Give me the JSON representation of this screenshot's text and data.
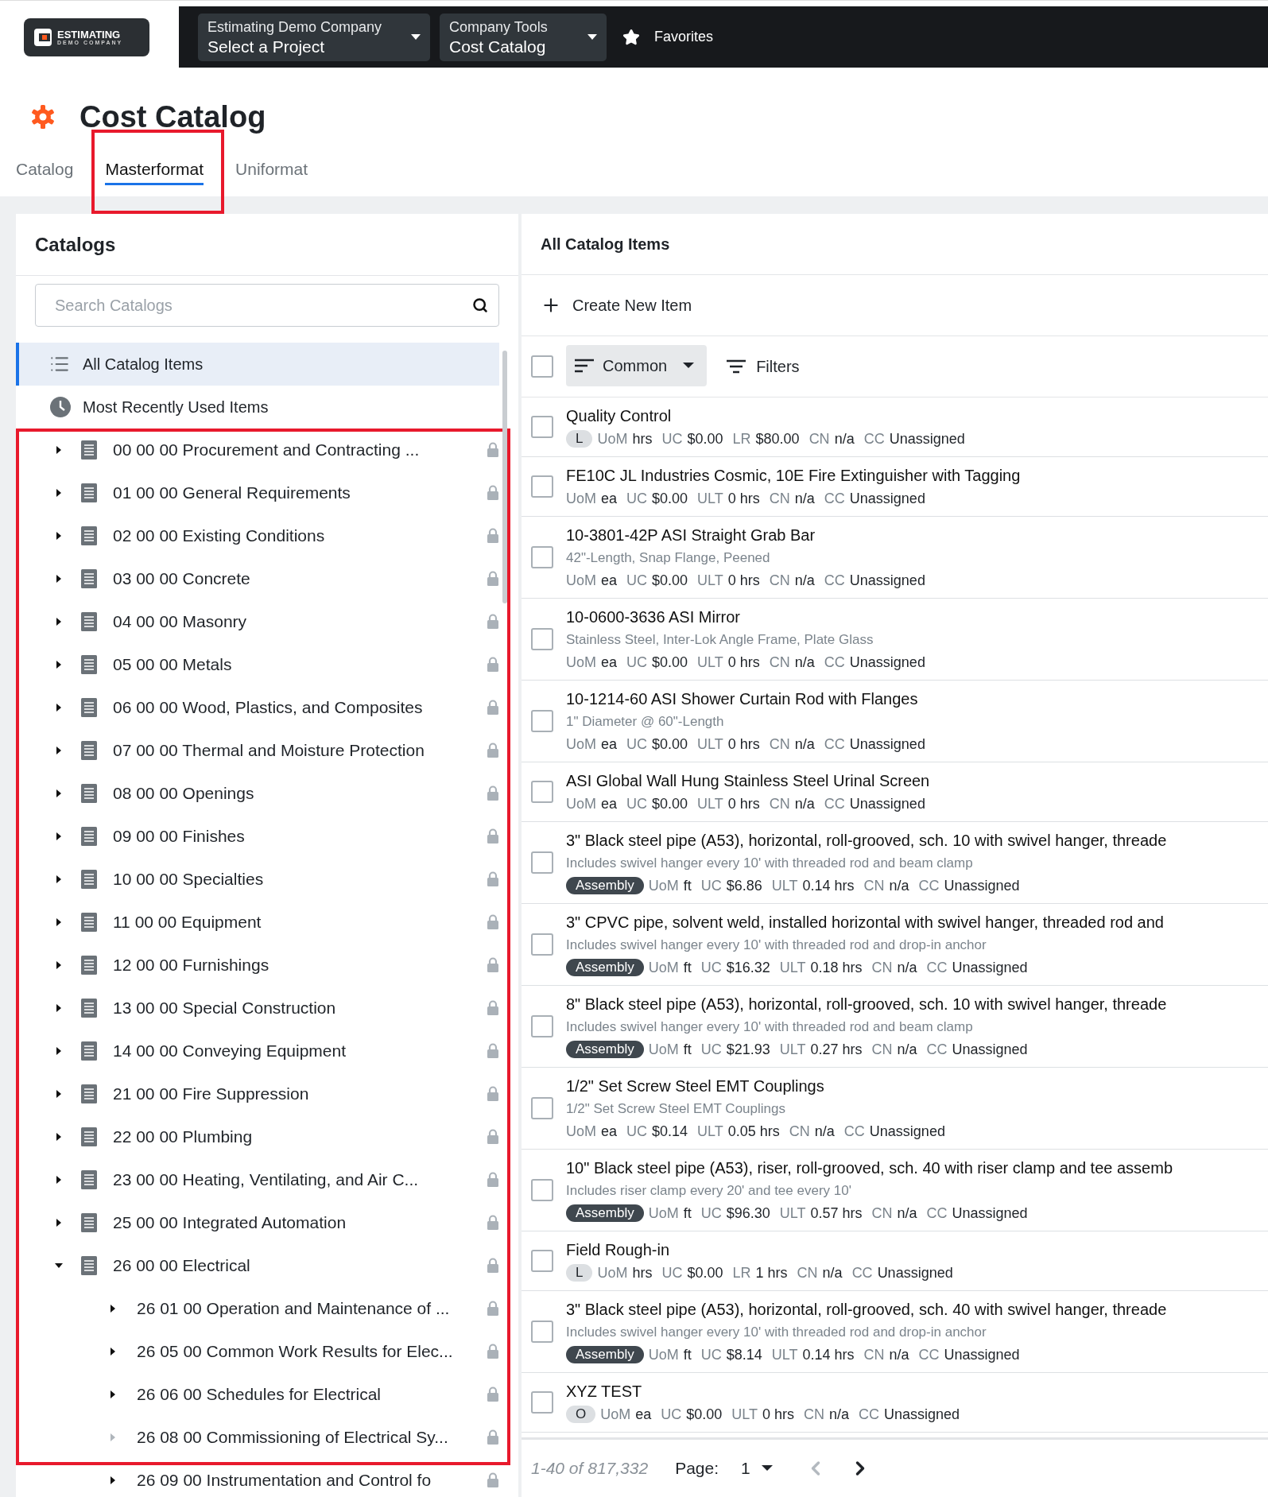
{
  "logo": {
    "title": "ESTIMATING",
    "subtitle": "DEMO COMPANY"
  },
  "nav": [
    {
      "top": "Estimating Demo Company",
      "bottom": "Select a Project"
    },
    {
      "top": "Company Tools",
      "bottom": "Cost Catalog"
    }
  ],
  "favorites": "Favorites",
  "page_title": "Cost Catalog",
  "tabs": [
    {
      "label": "Catalog",
      "selected": false,
      "highlighted": false
    },
    {
      "label": "Masterformat",
      "selected": true,
      "highlighted": true
    },
    {
      "label": "Uniformat",
      "selected": false,
      "highlighted": false
    }
  ],
  "catalogs": {
    "title": "Catalogs",
    "search": {
      "placeholder": "Search Catalogs"
    },
    "fixed": [
      {
        "kind": "list",
        "label": "All Catalog Items",
        "selected": true
      },
      {
        "kind": "clock",
        "label": "Most Recently Used Items",
        "selected": false
      }
    ],
    "tree_highlighted": true,
    "tree": [
      {
        "label": "00 00 00 Procurement and Contracting ...",
        "expanded": false,
        "expandable": true,
        "locked": true
      },
      {
        "label": "01 00 00 General Requirements",
        "expanded": false,
        "expandable": true,
        "locked": true
      },
      {
        "label": "02 00 00 Existing Conditions",
        "expanded": false,
        "expandable": true,
        "locked": true
      },
      {
        "label": "03 00 00 Concrete",
        "expanded": false,
        "expandable": true,
        "locked": true
      },
      {
        "label": "04 00 00 Masonry",
        "expanded": false,
        "expandable": true,
        "locked": true
      },
      {
        "label": "05 00 00 Metals",
        "expanded": false,
        "expandable": true,
        "locked": true
      },
      {
        "label": "06 00 00 Wood, Plastics, and Composites",
        "expanded": false,
        "expandable": true,
        "locked": true
      },
      {
        "label": "07 00 00 Thermal and Moisture Protection",
        "expanded": false,
        "expandable": true,
        "locked": true
      },
      {
        "label": "08 00 00 Openings",
        "expanded": false,
        "expandable": true,
        "locked": true
      },
      {
        "label": "09 00 00 Finishes",
        "expanded": false,
        "expandable": true,
        "locked": true
      },
      {
        "label": "10 00 00 Specialties",
        "expanded": false,
        "expandable": true,
        "locked": true
      },
      {
        "label": "11 00 00 Equipment",
        "expanded": false,
        "expandable": true,
        "locked": true
      },
      {
        "label": "12 00 00 Furnishings",
        "expanded": false,
        "expandable": true,
        "locked": true
      },
      {
        "label": "13 00 00 Special Construction",
        "expanded": false,
        "expandable": true,
        "locked": true
      },
      {
        "label": "14 00 00 Conveying Equipment",
        "expanded": false,
        "expandable": true,
        "locked": true
      },
      {
        "label": "21 00 00 Fire Suppression",
        "expanded": false,
        "expandable": true,
        "locked": true
      },
      {
        "label": "22 00 00 Plumbing",
        "expanded": false,
        "expandable": true,
        "locked": true
      },
      {
        "label": "23 00 00 Heating, Ventilating, and Air C...",
        "expanded": false,
        "expandable": true,
        "locked": true
      },
      {
        "label": "25 00 00 Integrated Automation",
        "expanded": false,
        "expandable": true,
        "locked": true
      },
      {
        "label": "26 00 00 Electrical",
        "expanded": true,
        "expandable": true,
        "locked": true,
        "children": [
          {
            "label": "26 01 00 Operation and Maintenance of ...",
            "expanded": false,
            "expandable": true,
            "locked": true
          },
          {
            "label": "26 05 00 Common Work Results for Elec...",
            "expanded": false,
            "expandable": true,
            "locked": true
          },
          {
            "label": "26 06 00 Schedules for Electrical",
            "expanded": false,
            "expandable": true,
            "locked": true
          },
          {
            "label": "26 08 00 Commissioning of Electrical Sy...",
            "expanded": false,
            "expandable": false,
            "locked": true
          },
          {
            "label": "26 09 00 Instrumentation and Control fo",
            "expanded": false,
            "expandable": true,
            "locked": true
          }
        ]
      }
    ]
  },
  "items_panel": {
    "title": "All Catalog Items",
    "create": "Create New Item",
    "sort": "Common",
    "filters": "Filters",
    "select_all": false,
    "items": [
      {
        "title": "Quality Control",
        "badge": {
          "label": "L",
          "kind": "light"
        },
        "checked": false,
        "meta": [
          {
            "label": "UoM",
            "value": "hrs"
          },
          {
            "label": "UC",
            "value": "$0.00"
          },
          {
            "label": "LR",
            "value": "$80.00"
          },
          {
            "label": "CN",
            "value": "n/a"
          },
          {
            "label": "CC",
            "value": "Unassigned"
          }
        ]
      },
      {
        "title": "FE10C JL Industries Cosmic, 10E Fire Extinguisher with Tagging",
        "checked": false,
        "meta": [
          {
            "label": "UoM",
            "value": "ea"
          },
          {
            "label": "UC",
            "value": "$0.00"
          },
          {
            "label": "ULT",
            "value": "0 hrs"
          },
          {
            "label": "CN",
            "value": "n/a"
          },
          {
            "label": "CC",
            "value": "Unassigned"
          }
        ]
      },
      {
        "title": "10-3801-42P ASI Straight Grab Bar",
        "subtitle": "42\"-Length, Snap Flange, Peened",
        "checked": false,
        "meta": [
          {
            "label": "UoM",
            "value": "ea"
          },
          {
            "label": "UC",
            "value": "$0.00"
          },
          {
            "label": "ULT",
            "value": "0 hrs"
          },
          {
            "label": "CN",
            "value": "n/a"
          },
          {
            "label": "CC",
            "value": "Unassigned"
          }
        ]
      },
      {
        "title": "10-0600-3636 ASI Mirror",
        "subtitle": "Stainless Steel, Inter-Lok Angle Frame, Plate Glass",
        "checked": false,
        "meta": [
          {
            "label": "UoM",
            "value": "ea"
          },
          {
            "label": "UC",
            "value": "$0.00"
          },
          {
            "label": "ULT",
            "value": "0 hrs"
          },
          {
            "label": "CN",
            "value": "n/a"
          },
          {
            "label": "CC",
            "value": "Unassigned"
          }
        ]
      },
      {
        "title": "10-1214-60 ASI Shower Curtain Rod with Flanges",
        "subtitle": "1\" Diameter @ 60\"-Length",
        "checked": false,
        "meta": [
          {
            "label": "UoM",
            "value": "ea"
          },
          {
            "label": "UC",
            "value": "$0.00"
          },
          {
            "label": "ULT",
            "value": "0 hrs"
          },
          {
            "label": "CN",
            "value": "n/a"
          },
          {
            "label": "CC",
            "value": "Unassigned"
          }
        ]
      },
      {
        "title": "ASI Global Wall Hung Stainless Steel Urinal Screen",
        "checked": false,
        "meta": [
          {
            "label": "UoM",
            "value": "ea"
          },
          {
            "label": "UC",
            "value": "$0.00"
          },
          {
            "label": "ULT",
            "value": "0 hrs"
          },
          {
            "label": "CN",
            "value": "n/a"
          },
          {
            "label": "CC",
            "value": "Unassigned"
          }
        ]
      },
      {
        "title": "3\" Black steel pipe (A53), horizontal, roll-grooved, sch. 10 with swivel hanger, threade",
        "subtitle": "Includes swivel hanger every 10' with threaded rod and beam clamp",
        "badge": {
          "label": "Assembly",
          "kind": "dark"
        },
        "checked": false,
        "meta": [
          {
            "label": "UoM",
            "value": "ft"
          },
          {
            "label": "UC",
            "value": "$6.86"
          },
          {
            "label": "ULT",
            "value": "0.14 hrs"
          },
          {
            "label": "CN",
            "value": "n/a"
          },
          {
            "label": "CC",
            "value": "Unassigned"
          }
        ]
      },
      {
        "title": "3\" CPVC pipe, solvent weld, installed horizontal with swivel hanger, threaded rod and",
        "subtitle": "Includes swivel hanger every 10' with threaded rod and drop-in anchor",
        "badge": {
          "label": "Assembly",
          "kind": "dark"
        },
        "checked": false,
        "meta": [
          {
            "label": "UoM",
            "value": "ft"
          },
          {
            "label": "UC",
            "value": "$16.32"
          },
          {
            "label": "ULT",
            "value": "0.18 hrs"
          },
          {
            "label": "CN",
            "value": "n/a"
          },
          {
            "label": "CC",
            "value": "Unassigned"
          }
        ]
      },
      {
        "title": "8\" Black steel pipe (A53), horizontal, roll-grooved, sch. 10 with swivel hanger, threade",
        "subtitle": "Includes swivel hanger every 10' with threaded rod and beam clamp",
        "badge": {
          "label": "Assembly",
          "kind": "dark"
        },
        "checked": false,
        "meta": [
          {
            "label": "UoM",
            "value": "ft"
          },
          {
            "label": "UC",
            "value": "$21.93"
          },
          {
            "label": "ULT",
            "value": "0.27 hrs"
          },
          {
            "label": "CN",
            "value": "n/a"
          },
          {
            "label": "CC",
            "value": "Unassigned"
          }
        ]
      },
      {
        "title": "1/2\" Set Screw Steel EMT Couplings",
        "subtitle": "1/2\" Set Screw Steel EMT Couplings",
        "checked": false,
        "meta": [
          {
            "label": "UoM",
            "value": "ea"
          },
          {
            "label": "UC",
            "value": "$0.14"
          },
          {
            "label": "ULT",
            "value": "0.05 hrs"
          },
          {
            "label": "CN",
            "value": "n/a"
          },
          {
            "label": "CC",
            "value": "Unassigned"
          }
        ]
      },
      {
        "title": "10\" Black steel pipe (A53), riser, roll-grooved, sch. 40 with riser clamp and tee assemb",
        "subtitle": "Includes riser clamp every 20' and tee every 10'",
        "badge": {
          "label": "Assembly",
          "kind": "dark"
        },
        "checked": false,
        "meta": [
          {
            "label": "UoM",
            "value": "ft"
          },
          {
            "label": "UC",
            "value": "$96.30"
          },
          {
            "label": "ULT",
            "value": "0.57 hrs"
          },
          {
            "label": "CN",
            "value": "n/a"
          },
          {
            "label": "CC",
            "value": "Unassigned"
          }
        ]
      },
      {
        "title": "Field Rough-in",
        "badge": {
          "label": "L",
          "kind": "light"
        },
        "checked": false,
        "meta": [
          {
            "label": "UoM",
            "value": "hrs"
          },
          {
            "label": "UC",
            "value": "$0.00"
          },
          {
            "label": "LR",
            "value": "1 hrs"
          },
          {
            "label": "CN",
            "value": "n/a"
          },
          {
            "label": "CC",
            "value": "Unassigned"
          }
        ]
      },
      {
        "title": "3\" Black steel pipe (A53), horizontal, roll-grooved, sch. 40 with swivel hanger, threade",
        "subtitle": "Includes swivel hanger every 10' with threaded rod and drop-in anchor",
        "badge": {
          "label": "Assembly",
          "kind": "dark"
        },
        "checked": false,
        "meta": [
          {
            "label": "UoM",
            "value": "ft"
          },
          {
            "label": "UC",
            "value": "$8.14"
          },
          {
            "label": "ULT",
            "value": "0.14 hrs"
          },
          {
            "label": "CN",
            "value": "n/a"
          },
          {
            "label": "CC",
            "value": "Unassigned"
          }
        ]
      },
      {
        "title": "XYZ TEST",
        "badge": {
          "label": "O",
          "kind": "light"
        },
        "checked": false,
        "meta": [
          {
            "label": "UoM",
            "value": "ea"
          },
          {
            "label": "UC",
            "value": "$0.00"
          },
          {
            "label": "ULT",
            "value": "0 hrs"
          },
          {
            "label": "CN",
            "value": "n/a"
          },
          {
            "label": "CC",
            "value": "Unassigned"
          }
        ]
      }
    ],
    "pagination": {
      "range": "1-40 of 817,332",
      "page_label": "Page:",
      "page": "1",
      "prev_disabled": true,
      "next_disabled": false
    }
  }
}
